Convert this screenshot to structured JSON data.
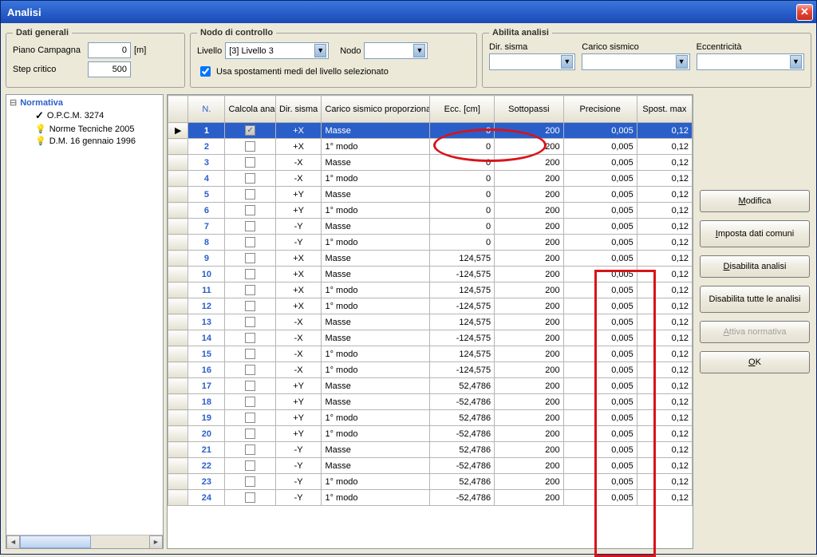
{
  "window": {
    "title": "Analisi"
  },
  "groups": {
    "dati_generali": {
      "legend": "Dati generali",
      "piano_label": "Piano Campagna",
      "piano_value": "0",
      "piano_unit": "[m]",
      "step_label": "Step critico",
      "step_value": "500"
    },
    "nodo_controllo": {
      "legend": "Nodo di controllo",
      "livello_label": "Livello",
      "livello_value": "[3]  Livello 3",
      "nodo_label": "Nodo",
      "nodo_value": "",
      "usa_spost_label": "Usa spostamenti medi del livello selezionato",
      "usa_spost_checked": true
    },
    "abilita_analisi": {
      "legend": "Abilita analisi",
      "dir_label": "Dir. sisma",
      "carico_label": "Carico sismico",
      "ecc_label": "Eccentricità"
    }
  },
  "tree": {
    "root": "Normativa",
    "items": [
      {
        "icon": "check",
        "label": "O.P.C.M. 3274"
      },
      {
        "icon": "bulb",
        "label": "Norme Tecniche 2005"
      },
      {
        "icon": "bulb",
        "label": "D.M. 16 gennaio 1996"
      }
    ]
  },
  "grid": {
    "headers": {
      "n": "N.",
      "calcola": "Calcola analisi",
      "dir": "Dir. sisma",
      "carico": "Carico sismico proporzionale",
      "ecc": "Ecc. [cm]",
      "sotto": "Sottopassi",
      "prec": "Precisione",
      "spost": "Spost. max"
    },
    "rows": [
      {
        "n": "1",
        "calc": true,
        "dir": "+X",
        "carico": "Masse",
        "ecc": "0",
        "sotto": "200",
        "prec": "0,005",
        "spost": "0,12",
        "sel": true
      },
      {
        "n": "2",
        "calc": false,
        "dir": "+X",
        "carico": "1° modo",
        "ecc": "0",
        "sotto": "200",
        "prec": "0,005",
        "spost": "0,12"
      },
      {
        "n": "3",
        "calc": false,
        "dir": "-X",
        "carico": "Masse",
        "ecc": "0",
        "sotto": "200",
        "prec": "0,005",
        "spost": "0,12"
      },
      {
        "n": "4",
        "calc": false,
        "dir": "-X",
        "carico": "1° modo",
        "ecc": "0",
        "sotto": "200",
        "prec": "0,005",
        "spost": "0,12"
      },
      {
        "n": "5",
        "calc": false,
        "dir": "+Y",
        "carico": "Masse",
        "ecc": "0",
        "sotto": "200",
        "prec": "0,005",
        "spost": "0,12"
      },
      {
        "n": "6",
        "calc": false,
        "dir": "+Y",
        "carico": "1° modo",
        "ecc": "0",
        "sotto": "200",
        "prec": "0,005",
        "spost": "0,12"
      },
      {
        "n": "7",
        "calc": false,
        "dir": "-Y",
        "carico": "Masse",
        "ecc": "0",
        "sotto": "200",
        "prec": "0,005",
        "spost": "0,12"
      },
      {
        "n": "8",
        "calc": false,
        "dir": "-Y",
        "carico": "1° modo",
        "ecc": "0",
        "sotto": "200",
        "prec": "0,005",
        "spost": "0,12"
      },
      {
        "n": "9",
        "calc": false,
        "dir": "+X",
        "carico": "Masse",
        "ecc": "124,575",
        "sotto": "200",
        "prec": "0,005",
        "spost": "0,12"
      },
      {
        "n": "10",
        "calc": false,
        "dir": "+X",
        "carico": "Masse",
        "ecc": "-124,575",
        "sotto": "200",
        "prec": "0,005",
        "spost": "0,12"
      },
      {
        "n": "11",
        "calc": false,
        "dir": "+X",
        "carico": "1° modo",
        "ecc": "124,575",
        "sotto": "200",
        "prec": "0,005",
        "spost": "0,12"
      },
      {
        "n": "12",
        "calc": false,
        "dir": "+X",
        "carico": "1° modo",
        "ecc": "-124,575",
        "sotto": "200",
        "prec": "0,005",
        "spost": "0,12"
      },
      {
        "n": "13",
        "calc": false,
        "dir": "-X",
        "carico": "Masse",
        "ecc": "124,575",
        "sotto": "200",
        "prec": "0,005",
        "spost": "0,12"
      },
      {
        "n": "14",
        "calc": false,
        "dir": "-X",
        "carico": "Masse",
        "ecc": "-124,575",
        "sotto": "200",
        "prec": "0,005",
        "spost": "0,12"
      },
      {
        "n": "15",
        "calc": false,
        "dir": "-X",
        "carico": "1° modo",
        "ecc": "124,575",
        "sotto": "200",
        "prec": "0,005",
        "spost": "0,12"
      },
      {
        "n": "16",
        "calc": false,
        "dir": "-X",
        "carico": "1° modo",
        "ecc": "-124,575",
        "sotto": "200",
        "prec": "0,005",
        "spost": "0,12"
      },
      {
        "n": "17",
        "calc": false,
        "dir": "+Y",
        "carico": "Masse",
        "ecc": "52,4786",
        "sotto": "200",
        "prec": "0,005",
        "spost": "0,12"
      },
      {
        "n": "18",
        "calc": false,
        "dir": "+Y",
        "carico": "Masse",
        "ecc": "-52,4786",
        "sotto": "200",
        "prec": "0,005",
        "spost": "0,12"
      },
      {
        "n": "19",
        "calc": false,
        "dir": "+Y",
        "carico": "1° modo",
        "ecc": "52,4786",
        "sotto": "200",
        "prec": "0,005",
        "spost": "0,12"
      },
      {
        "n": "20",
        "calc": false,
        "dir": "+Y",
        "carico": "1° modo",
        "ecc": "-52,4786",
        "sotto": "200",
        "prec": "0,005",
        "spost": "0,12"
      },
      {
        "n": "21",
        "calc": false,
        "dir": "-Y",
        "carico": "Masse",
        "ecc": "52,4786",
        "sotto": "200",
        "prec": "0,005",
        "spost": "0,12"
      },
      {
        "n": "22",
        "calc": false,
        "dir": "-Y",
        "carico": "Masse",
        "ecc": "-52,4786",
        "sotto": "200",
        "prec": "0,005",
        "spost": "0,12"
      },
      {
        "n": "23",
        "calc": false,
        "dir": "-Y",
        "carico": "1° modo",
        "ecc": "52,4786",
        "sotto": "200",
        "prec": "0,005",
        "spost": "0,12"
      },
      {
        "n": "24",
        "calc": false,
        "dir": "-Y",
        "carico": "1° modo",
        "ecc": "-52,4786",
        "sotto": "200",
        "prec": "0,005",
        "spost": "0,12"
      }
    ]
  },
  "buttons": {
    "modifica": "Modifica",
    "imposta": "Imposta dati comuni",
    "disabilita": "Disabilita analisi",
    "disabilita_tutte": "Disabilita tutte le analisi",
    "attiva_norm": "Attiva normativa",
    "ok": "OK"
  }
}
